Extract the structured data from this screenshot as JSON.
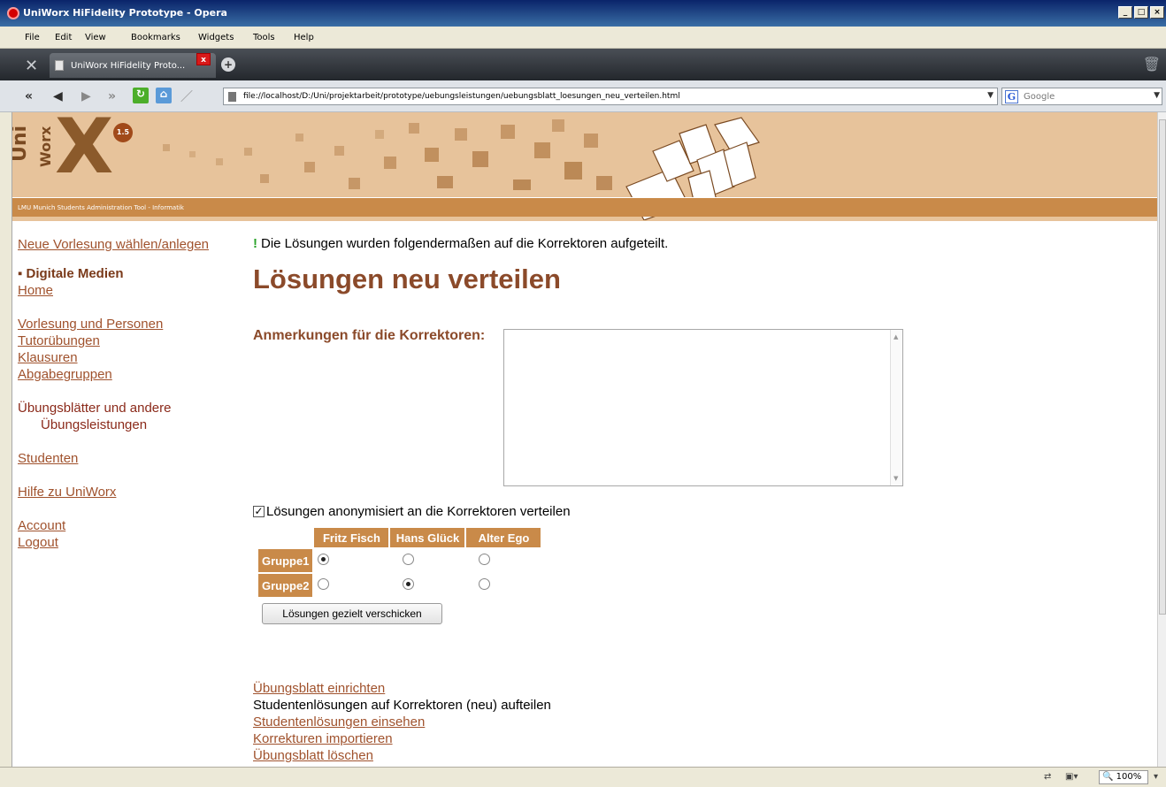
{
  "window": {
    "title": "UniWorx HiFidelity Prototype - Opera",
    "buttons": [
      "_",
      "□",
      "×"
    ]
  },
  "menu": [
    "File",
    "Edit",
    "View",
    "Bookmarks",
    "Widgets",
    "Tools",
    "Help"
  ],
  "tab": {
    "label": "UniWorx HiFidelity Proto...",
    "close": "x",
    "new_tab": "+"
  },
  "address": {
    "url": "file://localhost/D:/Uni/projektarbeit/prototype/uebungsleistungen/uebungsblatt_loesungen_neu_verteilen.html",
    "search_placeholder": "Google",
    "search_engine_glyph": "G"
  },
  "banner": {
    "logo_uni": "Uni",
    "logo_worx": "Worx",
    "logo_x": "X",
    "logo_badge": "1.5",
    "tagline": "LMU Munich Students Administration Tool - Informatik",
    "colors": {
      "sand": "#e7c39b",
      "brown": "#c98a49"
    }
  },
  "nav": {
    "new_lecture": "Neue Vorlesung wählen/anlegen",
    "course": "Digitale Medien",
    "home": "Home",
    "lecture_people": "Vorlesung und Personen",
    "tutorials": "Tutorübungen",
    "exams": "Klausuren",
    "groups": "Abgabegruppen",
    "exercises_line1": "Übungsblätter und andere",
    "exercises_line2": "Übungsleistungen",
    "students": "Studenten",
    "help": "Hilfe zu UniWorx",
    "account": "Account",
    "logout": "Logout"
  },
  "main": {
    "message": "Die Lösungen wurden folgendermaßen auf die Korrektoren aufgeteilt.",
    "title": "Lösungen neu verteilen",
    "notes_label": "Anmerkungen für die Korrektoren:",
    "notes_value": "",
    "anon_label": "Lösungen anonymisiert an die Korrektoren verteilen",
    "anon_checked": true,
    "grid": {
      "correctors": [
        "Fritz Fisch",
        "Hans Glück",
        "Alter Ego"
      ],
      "rows": [
        {
          "group": "Gruppe1",
          "selected": 0
        },
        {
          "group": "Gruppe2",
          "selected": 1
        }
      ]
    },
    "send_button": "Lösungen gezielt verschicken",
    "bottom_links": {
      "setup": "Übungsblatt einrichten",
      "current": "Studentenlösungen auf Korrektoren (neu) aufteilen",
      "view": "Studentenlösungen einsehen",
      "import": "Korrekturen importieren",
      "delete": "Übungsblatt löschen"
    }
  },
  "status": {
    "zoom": "100%"
  }
}
